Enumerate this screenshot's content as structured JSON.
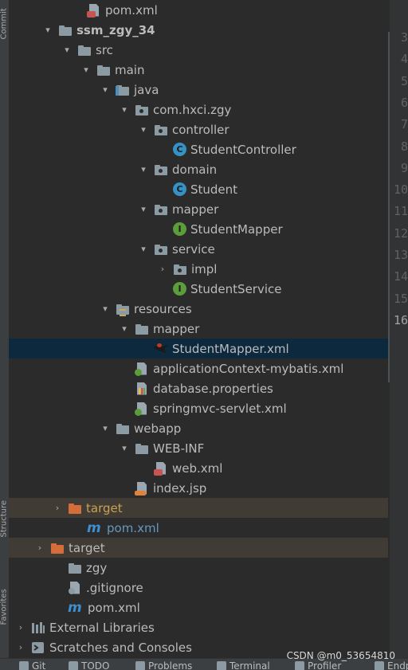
{
  "left_strip": {
    "labels": [
      "Commit",
      "Structure",
      "Favorites"
    ]
  },
  "tree": [
    {
      "label": "pom.xml",
      "icon": "xml-file-icon",
      "arrow": "",
      "bold": false,
      "color": "default"
    },
    {
      "label": "ssm_zgy_34",
      "icon": "module-folder-icon",
      "arrow": "▾",
      "bold": true,
      "color": "default"
    },
    {
      "label": "src",
      "icon": "folder-icon",
      "arrow": "▾",
      "bold": false,
      "color": "default"
    },
    {
      "label": "main",
      "icon": "folder-icon",
      "arrow": "▾",
      "bold": false,
      "color": "default"
    },
    {
      "label": "java",
      "icon": "source-folder-icon",
      "arrow": "▾",
      "bold": false,
      "color": "default"
    },
    {
      "label": "com.hxci.zgy",
      "icon": "package-icon",
      "arrow": "▾",
      "bold": false,
      "color": "default"
    },
    {
      "label": "controller",
      "icon": "package-icon",
      "arrow": "▾",
      "bold": false,
      "color": "default"
    },
    {
      "label": "StudentController",
      "icon": "class-icon",
      "arrow": "",
      "bold": false,
      "color": "default"
    },
    {
      "label": "domain",
      "icon": "package-icon",
      "arrow": "▾",
      "bold": false,
      "color": "default"
    },
    {
      "label": "Student",
      "icon": "class-icon",
      "arrow": "",
      "bold": false,
      "color": "default"
    },
    {
      "label": "mapper",
      "icon": "package-icon",
      "arrow": "▾",
      "bold": false,
      "color": "default"
    },
    {
      "label": "StudentMapper",
      "icon": "interface-icon",
      "arrow": "",
      "bold": false,
      "color": "default"
    },
    {
      "label": "service",
      "icon": "package-icon",
      "arrow": "▾",
      "bold": false,
      "color": "default"
    },
    {
      "label": "impl",
      "icon": "package-icon",
      "arrow": "›",
      "bold": false,
      "color": "default"
    },
    {
      "label": "StudentService",
      "icon": "interface-icon",
      "arrow": "",
      "bold": false,
      "color": "default"
    },
    {
      "label": "resources",
      "icon": "resources-folder-icon",
      "arrow": "▾",
      "bold": false,
      "color": "default"
    },
    {
      "label": "mapper",
      "icon": "folder-icon",
      "arrow": "▾",
      "bold": false,
      "color": "default"
    },
    {
      "label": "StudentMapper.xml",
      "icon": "mybatis-xml-icon",
      "arrow": "",
      "bold": false,
      "color": "default",
      "selected": true
    },
    {
      "label": "applicationContext-mybatis.xml",
      "icon": "spring-xml-icon",
      "arrow": "",
      "bold": false,
      "color": "default"
    },
    {
      "label": "database.properties",
      "icon": "properties-file-icon",
      "arrow": "",
      "bold": false,
      "color": "default"
    },
    {
      "label": "springmvc-servlet.xml",
      "icon": "spring-xml-icon",
      "arrow": "",
      "bold": false,
      "color": "default"
    },
    {
      "label": "webapp",
      "icon": "web-folder-icon",
      "arrow": "▾",
      "bold": false,
      "color": "default"
    },
    {
      "label": "WEB-INF",
      "icon": "folder-icon",
      "arrow": "▾",
      "bold": false,
      "color": "default"
    },
    {
      "label": "web.xml",
      "icon": "web-xml-icon",
      "arrow": "",
      "bold": false,
      "color": "default"
    },
    {
      "label": "index.jsp",
      "icon": "jsp-file-icon",
      "arrow": "",
      "bold": false,
      "color": "default"
    },
    {
      "label": "target",
      "icon": "excluded-folder-icon",
      "arrow": "›",
      "bold": false,
      "color": "orange",
      "excluded": true
    },
    {
      "label": "pom.xml",
      "icon": "maven-icon",
      "arrow": "",
      "bold": false,
      "color": "blue"
    },
    {
      "label": "target",
      "icon": "excluded-folder-icon",
      "arrow": "›",
      "bold": false,
      "color": "default",
      "excluded": true
    },
    {
      "label": "zgy",
      "icon": "folder-icon",
      "arrow": "",
      "bold": false,
      "color": "default"
    },
    {
      "label": ".gitignore",
      "icon": "ignore-file-icon",
      "arrow": "",
      "bold": false,
      "color": "default"
    },
    {
      "label": "pom.xml",
      "icon": "maven-icon",
      "arrow": "",
      "bold": false,
      "color": "default"
    },
    {
      "label": "External Libraries",
      "icon": "libraries-icon",
      "arrow": "›",
      "bold": false,
      "color": "default"
    },
    {
      "label": "Scratches and Consoles",
      "icon": "scratches-icon",
      "arrow": "›",
      "bold": false,
      "color": "default"
    }
  ],
  "gutter": {
    "line_numbers": [
      "3",
      "4",
      "5",
      "6",
      "7",
      "8",
      "9",
      "10",
      "11",
      "12",
      "13",
      "14",
      "15",
      "16"
    ],
    "active_line": "16"
  },
  "bottom_bar": {
    "items": [
      "Git",
      "TODO",
      "Problems",
      "Terminal",
      "Profiler",
      "Endp"
    ]
  },
  "watermark": "CSDN @m0_53654810",
  "colors": {
    "background": "#2b2b2b",
    "selection": "#0d293e",
    "excluded_row": "#403c35",
    "orange_text": "#c8a152",
    "maven_blue": "#6897bb"
  }
}
